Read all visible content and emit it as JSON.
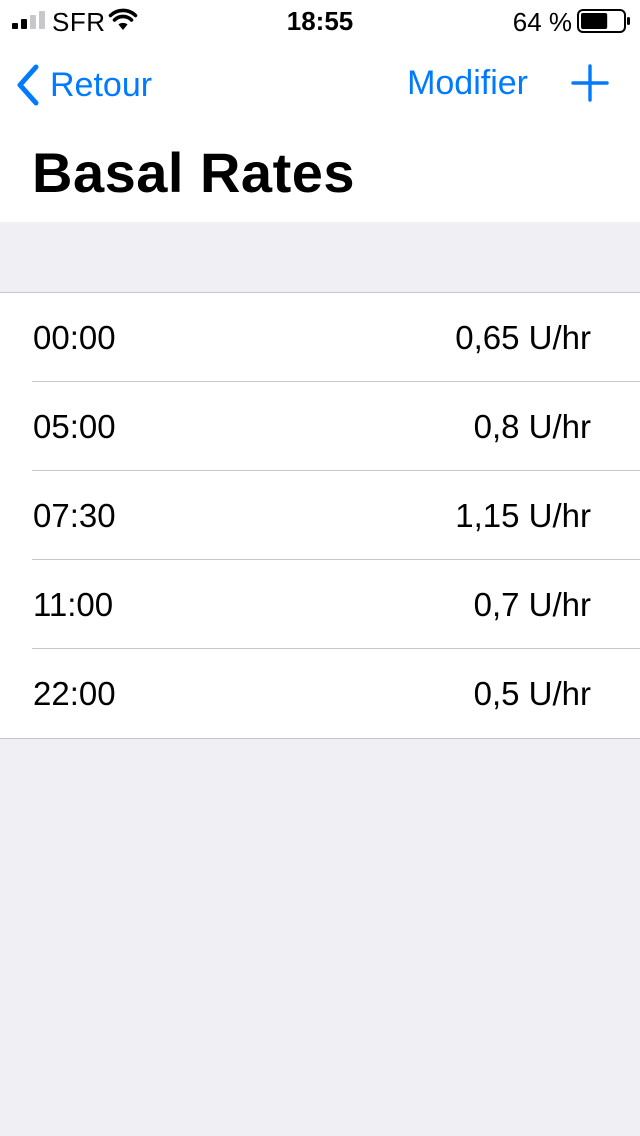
{
  "status_bar": {
    "carrier": "SFR",
    "time": "18:55",
    "battery_percent": "64 %",
    "battery_level": 0.64,
    "signal_bars_filled": 2,
    "signal_bars_total": 4
  },
  "nav": {
    "back_label": "Retour",
    "edit_label": "Modifier",
    "accent_color": "#007aff"
  },
  "page": {
    "title": "Basal Rates"
  },
  "schedule": [
    {
      "time": "00:00",
      "rate": "0,65 U/hr"
    },
    {
      "time": "05:00",
      "rate": "0,8 U/hr"
    },
    {
      "time": "07:30",
      "rate": "1,15 U/hr"
    },
    {
      "time": "11:00",
      "rate": "0,7 U/hr"
    },
    {
      "time": "22:00",
      "rate": "0,5 U/hr"
    }
  ]
}
